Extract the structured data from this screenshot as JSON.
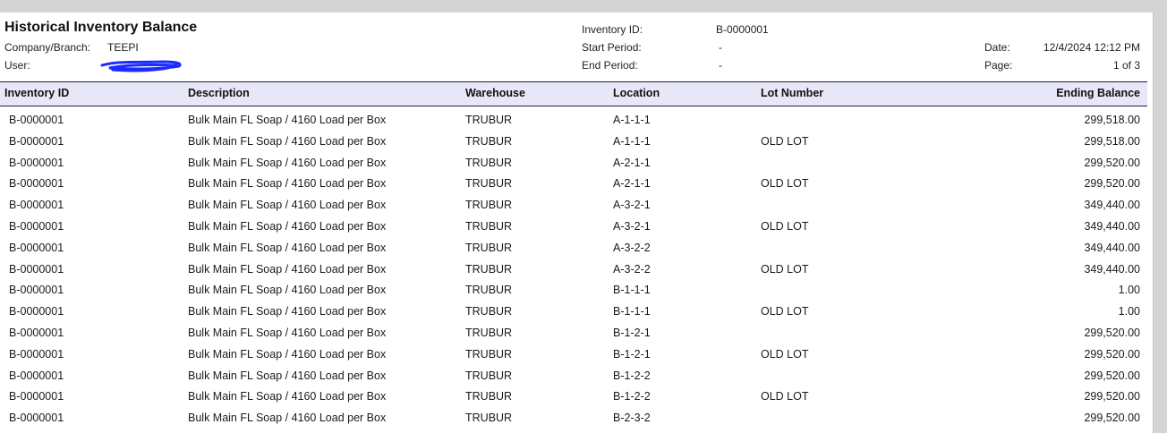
{
  "report": {
    "title": "Historical Inventory Balance",
    "company_label": "Company/Branch:",
    "company_value": "TEEPI",
    "user_label": "User:",
    "inventory_id_label": "Inventory ID:",
    "inventory_id_value": "B-0000001",
    "start_period_label": "Start Period:",
    "start_period_value": "-",
    "end_period_label": "End Period:",
    "end_period_value": "-",
    "date_label": "Date:",
    "date_value": "12/4/2024 12:12 PM",
    "page_label": "Page:",
    "page_value": "1 of 3",
    "scribble_color": "#1a2bff"
  },
  "columns": {
    "inventory_id": "Inventory ID",
    "description": "Description",
    "warehouse": "Warehouse",
    "location": "Location",
    "lot_number": "Lot Number",
    "ending_balance": "Ending Balance"
  },
  "rows": [
    {
      "inventory_id": "B-0000001",
      "description": "Bulk Main FL Soap / 4160 Load per Box",
      "warehouse": "TRUBUR",
      "location": "A-1-1-1",
      "lot_number": "",
      "ending_balance": "299,518.00"
    },
    {
      "inventory_id": "B-0000001",
      "description": "Bulk Main FL Soap / 4160 Load per Box",
      "warehouse": "TRUBUR",
      "location": "A-1-1-1",
      "lot_number": "OLD LOT",
      "ending_balance": "299,518.00"
    },
    {
      "inventory_id": "B-0000001",
      "description": "Bulk Main FL Soap / 4160 Load per Box",
      "warehouse": "TRUBUR",
      "location": "A-2-1-1",
      "lot_number": "",
      "ending_balance": "299,520.00"
    },
    {
      "inventory_id": "B-0000001",
      "description": "Bulk Main FL Soap / 4160 Load per Box",
      "warehouse": "TRUBUR",
      "location": "A-2-1-1",
      "lot_number": "OLD LOT",
      "ending_balance": "299,520.00"
    },
    {
      "inventory_id": "B-0000001",
      "description": "Bulk Main FL Soap / 4160 Load per Box",
      "warehouse": "TRUBUR",
      "location": "A-3-2-1",
      "lot_number": "",
      "ending_balance": "349,440.00"
    },
    {
      "inventory_id": "B-0000001",
      "description": "Bulk Main FL Soap / 4160 Load per Box",
      "warehouse": "TRUBUR",
      "location": "A-3-2-1",
      "lot_number": "OLD LOT",
      "ending_balance": "349,440.00"
    },
    {
      "inventory_id": "B-0000001",
      "description": "Bulk Main FL Soap / 4160 Load per Box",
      "warehouse": "TRUBUR",
      "location": "A-3-2-2",
      "lot_number": "",
      "ending_balance": "349,440.00"
    },
    {
      "inventory_id": "B-0000001",
      "description": "Bulk Main FL Soap / 4160 Load per Box",
      "warehouse": "TRUBUR",
      "location": "A-3-2-2",
      "lot_number": "OLD LOT",
      "ending_balance": "349,440.00"
    },
    {
      "inventory_id": "B-0000001",
      "description": "Bulk Main FL Soap / 4160 Load per Box",
      "warehouse": "TRUBUR",
      "location": "B-1-1-1",
      "lot_number": "",
      "ending_balance": "1.00"
    },
    {
      "inventory_id": "B-0000001",
      "description": "Bulk Main FL Soap / 4160 Load per Box",
      "warehouse": "TRUBUR",
      "location": "B-1-1-1",
      "lot_number": "OLD LOT",
      "ending_balance": "1.00"
    },
    {
      "inventory_id": "B-0000001",
      "description": "Bulk Main FL Soap / 4160 Load per Box",
      "warehouse": "TRUBUR",
      "location": "B-1-2-1",
      "lot_number": "",
      "ending_balance": "299,520.00"
    },
    {
      "inventory_id": "B-0000001",
      "description": "Bulk Main FL Soap / 4160 Load per Box",
      "warehouse": "TRUBUR",
      "location": "B-1-2-1",
      "lot_number": "OLD LOT",
      "ending_balance": "299,520.00"
    },
    {
      "inventory_id": "B-0000001",
      "description": "Bulk Main FL Soap / 4160 Load per Box",
      "warehouse": "TRUBUR",
      "location": "B-1-2-2",
      "lot_number": "",
      "ending_balance": "299,520.00"
    },
    {
      "inventory_id": "B-0000001",
      "description": "Bulk Main FL Soap / 4160 Load per Box",
      "warehouse": "TRUBUR",
      "location": "B-1-2-2",
      "lot_number": "OLD LOT",
      "ending_balance": "299,520.00"
    },
    {
      "inventory_id": "B-0000001",
      "description": "Bulk Main FL Soap / 4160 Load per Box",
      "warehouse": "TRUBUR",
      "location": "B-2-3-2",
      "lot_number": "",
      "ending_balance": "299,520.00"
    }
  ]
}
